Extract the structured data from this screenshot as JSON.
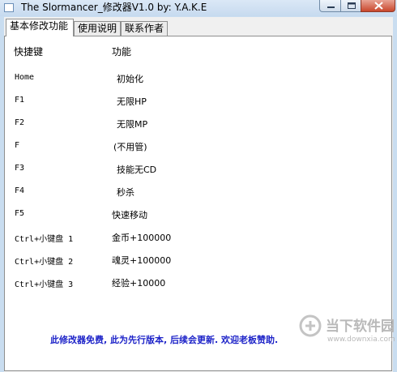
{
  "window": {
    "title": "The Slormancer_修改器V1.0 by: Y.A.K.E"
  },
  "tabs": [
    {
      "label": "基本修改功能",
      "active": true
    },
    {
      "label": "使用说明",
      "active": false
    },
    {
      "label": "联系作者",
      "active": false
    }
  ],
  "table": {
    "header_key": "快捷键",
    "header_func": "功能",
    "rows": [
      {
        "key": "Home",
        "func": "初始化"
      },
      {
        "key": "F1",
        "func": "无限HP"
      },
      {
        "key": "F2",
        "func": "无限MP"
      },
      {
        "key": "F",
        "func": "(不用管)"
      },
      {
        "key": "F3",
        "func": "技能无CD"
      },
      {
        "key": "F4",
        "func": "秒杀"
      },
      {
        "key": "F5",
        "func": "快速移动"
      },
      {
        "key": "Ctrl+小键盘 1",
        "func": "金币+100000"
      },
      {
        "key": "Ctrl+小键盘 2",
        "func": "魂灵+100000"
      },
      {
        "key": "Ctrl+小键盘 3",
        "func": "经验+10000"
      }
    ]
  },
  "footer": "此修改器免费, 此为先行版本, 后续会更新. 欢迎老板赞助.",
  "watermark": {
    "main": "当下软件园",
    "url": "www.downxia.com"
  },
  "colors": {
    "footer_text": "#1c22c8",
    "titlebar": "#c9ddf0",
    "close_button": "#c9472c"
  }
}
